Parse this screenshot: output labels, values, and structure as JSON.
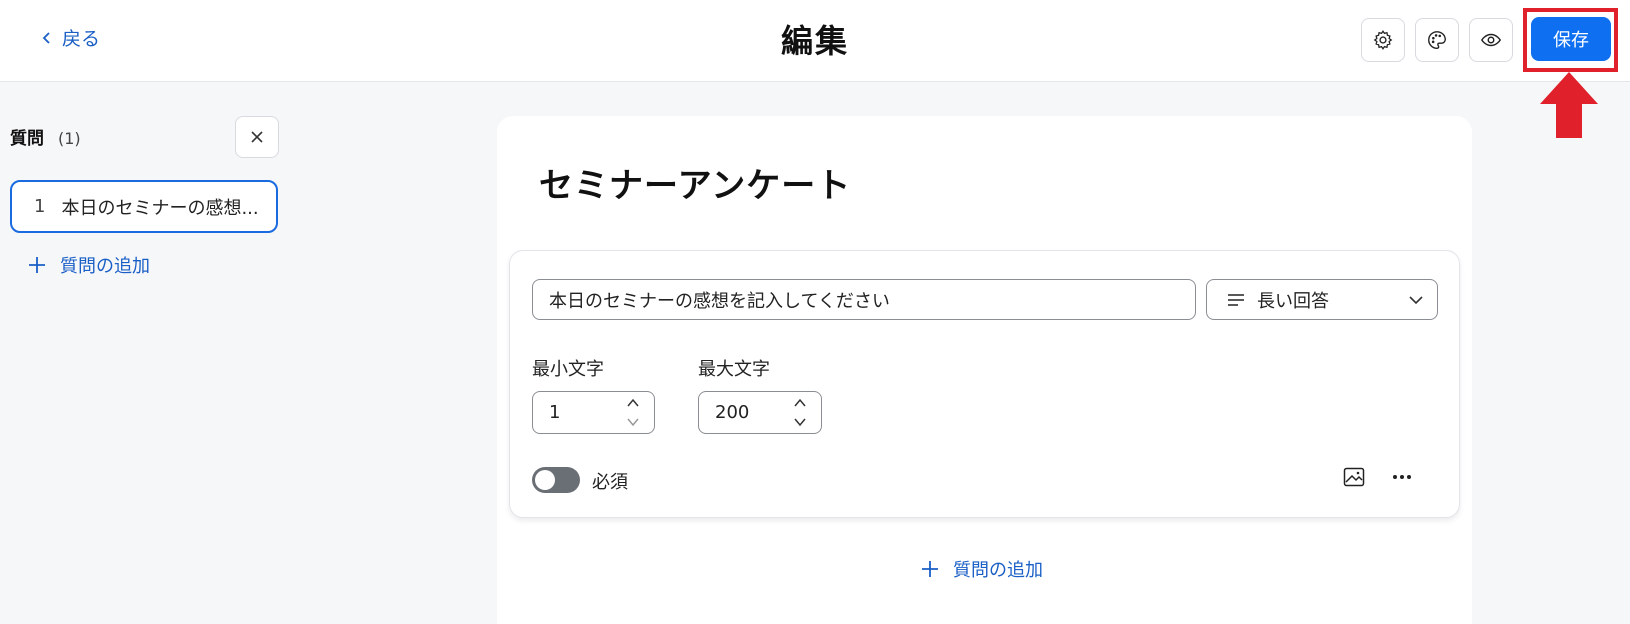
{
  "header": {
    "back_label": "戻る",
    "title": "編集",
    "save_label": "保存",
    "settings_icon": "gear-icon",
    "theme_icon": "palette-icon",
    "preview_icon": "eye-icon",
    "accent_color": "#0e6ff0",
    "highlight_color": "#e0202a"
  },
  "sidebar": {
    "heading": "質問",
    "count": "(1)",
    "items": [
      {
        "number": "1",
        "label": "本日のセミナーの感想..."
      }
    ],
    "add_label": "質問の追加"
  },
  "form": {
    "title": "セミナーアンケート",
    "question": {
      "text": "本日のセミナーの感想を記入してください",
      "type_label": "長い回答",
      "min_label": "最小文字",
      "min_value": "1",
      "max_label": "最大文字",
      "max_value": "200",
      "required_label": "必須",
      "required": false
    },
    "add_label": "質問の追加"
  }
}
